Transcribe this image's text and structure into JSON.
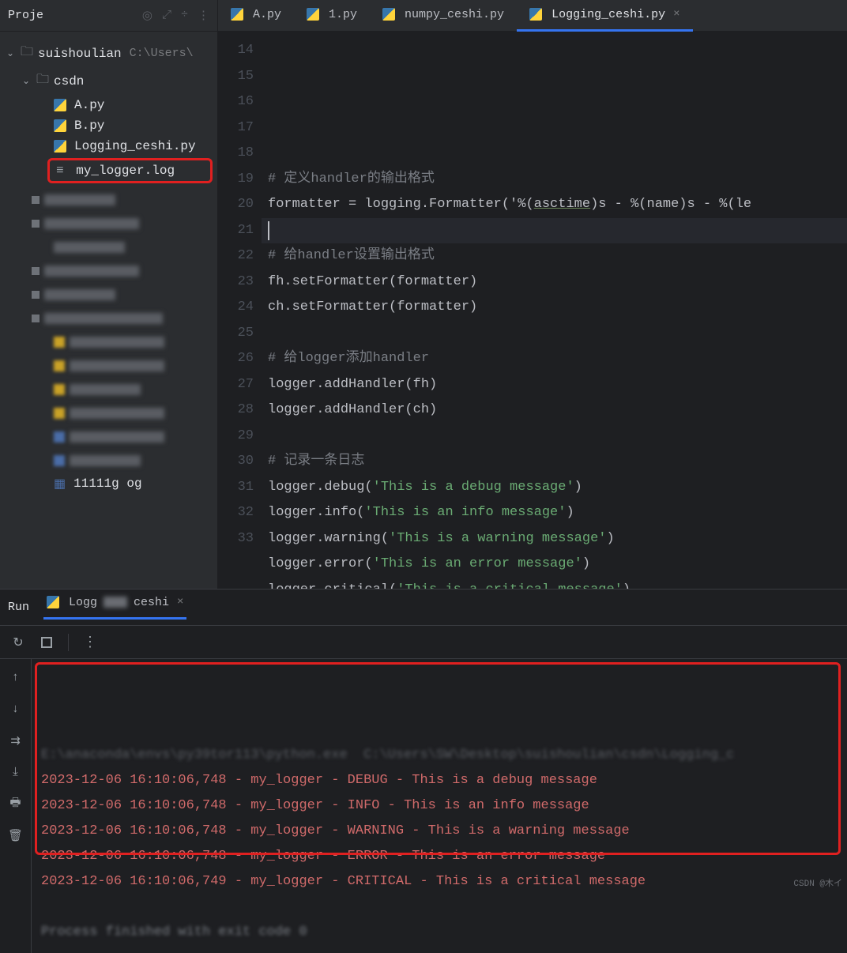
{
  "project": {
    "header": "Proje",
    "root": {
      "name": "suishoulian",
      "path": "C:\\Users\\"
    },
    "csdn_folder": "csdn",
    "files": {
      "a": "A.py",
      "b": "B.py",
      "logging": "Logging_ceshi.py",
      "logfile": "my_logger.log",
      "last_visible": "11111g       og"
    }
  },
  "editor": {
    "tabs": [
      {
        "label": "A.py",
        "active": false,
        "close": false
      },
      {
        "label": "1.py",
        "active": false,
        "close": false
      },
      {
        "label": "numpy_ceshi.py",
        "active": false,
        "close": false
      },
      {
        "label": "Logging_ceshi.py",
        "active": true,
        "close": true
      }
    ],
    "tab_close": "×",
    "line_start": 14,
    "lines": [
      "",
      "# 定义handler的输出格式",
      "formatter = logging.Formatter('%(asctime)s - %(name)s - %(le",
      "",
      "# 给handler设置输出格式",
      "fh.setFormatter(formatter)",
      "ch.setFormatter(formatter)",
      "",
      "# 给logger添加handler",
      "logger.addHandler(fh)",
      "logger.addHandler(ch)",
      "",
      "# 记录一条日志",
      "logger.debug('This is a debug message')",
      "logger.info('This is an info message')",
      "logger.warning('This is a warning message')",
      "logger.error('This is an error message')",
      "logger.critical('This is a critical message')",
      "",
      ""
    ]
  },
  "run": {
    "title": "Run",
    "tab_prefix": "Logg",
    "tab_suffix": "ceshi",
    "close": "×",
    "command_line": "E:\\anaconda\\envs\\py39tor113\\python.exe  C:\\Users\\SW\\Desktop\\suishoulian\\csdn\\Logging_c",
    "logs": [
      "2023-12-06 16:10:06,748 - my_logger - DEBUG - This is a debug message",
      "2023-12-06 16:10:06,748 - my_logger - INFO - This is an info message",
      "2023-12-06 16:10:06,748 - my_logger - WARNING - This is a warning message",
      "2023-12-06 16:10:06,748 - my_logger - ERROR - This is an error message",
      "2023-12-06 16:10:06,749 - my_logger - CRITICAL - This is a critical message"
    ],
    "exit_line": "Process finished with exit code 0"
  },
  "watermark": "CSDN @木イ"
}
